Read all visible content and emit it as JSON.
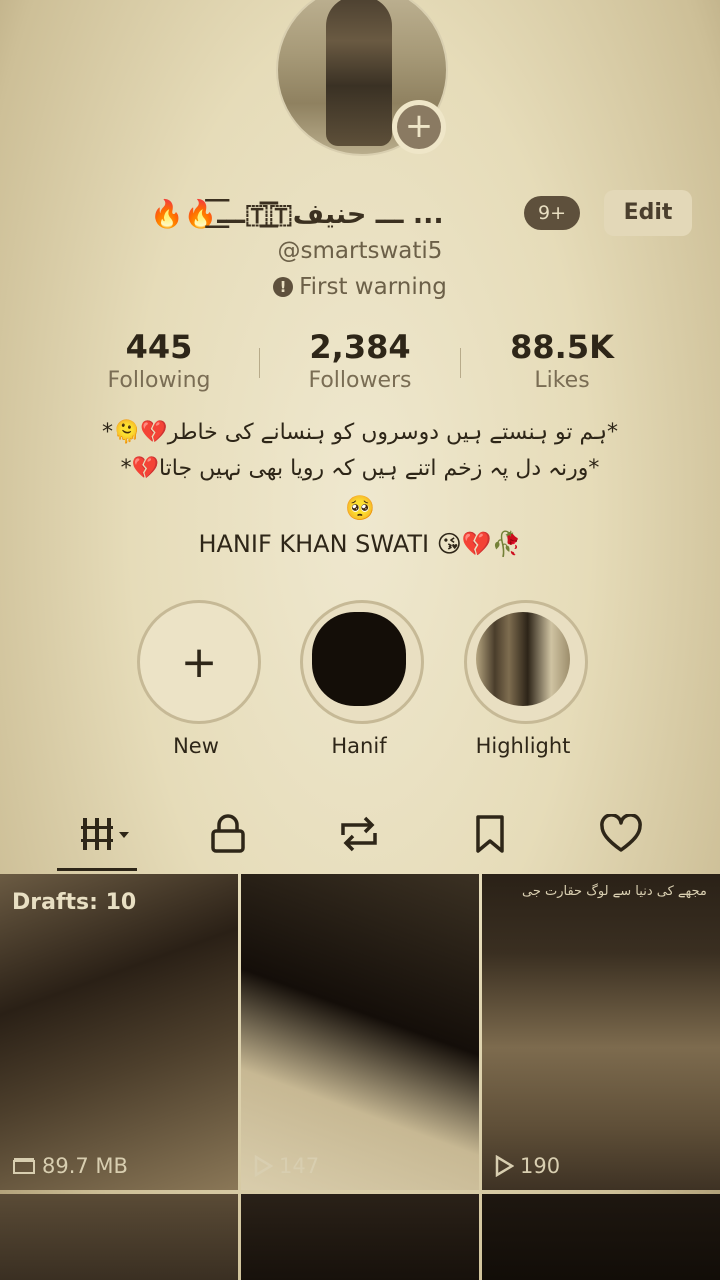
{
  "profile": {
    "name": "🔥🔥ـــ͟͞͞🇹͟͞͞🇹ـــ حنیف ...",
    "notification_count": "9+",
    "edit_label": "Edit",
    "handle": "@smartswati5",
    "warning": "First warning",
    "avatar_add": "+"
  },
  "stats": [
    {
      "value": "445",
      "label": "Following"
    },
    {
      "value": "2,384",
      "label": "Followers"
    },
    {
      "value": "88.5K",
      "label": "Likes"
    }
  ],
  "bio": {
    "line1": "*ہم تو ہنستے ہیں دوسروں کو ہنسانے کی خاطر💔🫠*",
    "line2": "*ورنہ دل پہ زخم اتنے ہیں کہ رویا بھی نہیں جاتا💔*",
    "line3": "🥺",
    "line4": "HANIF KHAN SWATI 😘💔🥀"
  },
  "highlights": [
    {
      "label": "New",
      "icon": "+"
    },
    {
      "label": "Hanif"
    },
    {
      "label": "Highlight"
    }
  ],
  "tabs": [
    "videos-grid-icon",
    "lock-icon",
    "repost-icon",
    "bookmark-icon",
    "heart-icon"
  ],
  "grid": [
    {
      "overlay": "Drafts: 10",
      "meta": "89.7 MB",
      "meta_icon": "storage-icon"
    },
    {
      "meta": "147",
      "meta_icon": "play-icon"
    },
    {
      "meta": "190",
      "meta_icon": "play-icon",
      "caption": "مجھے کی دنیا سے لوگ حقارت جی"
    }
  ]
}
